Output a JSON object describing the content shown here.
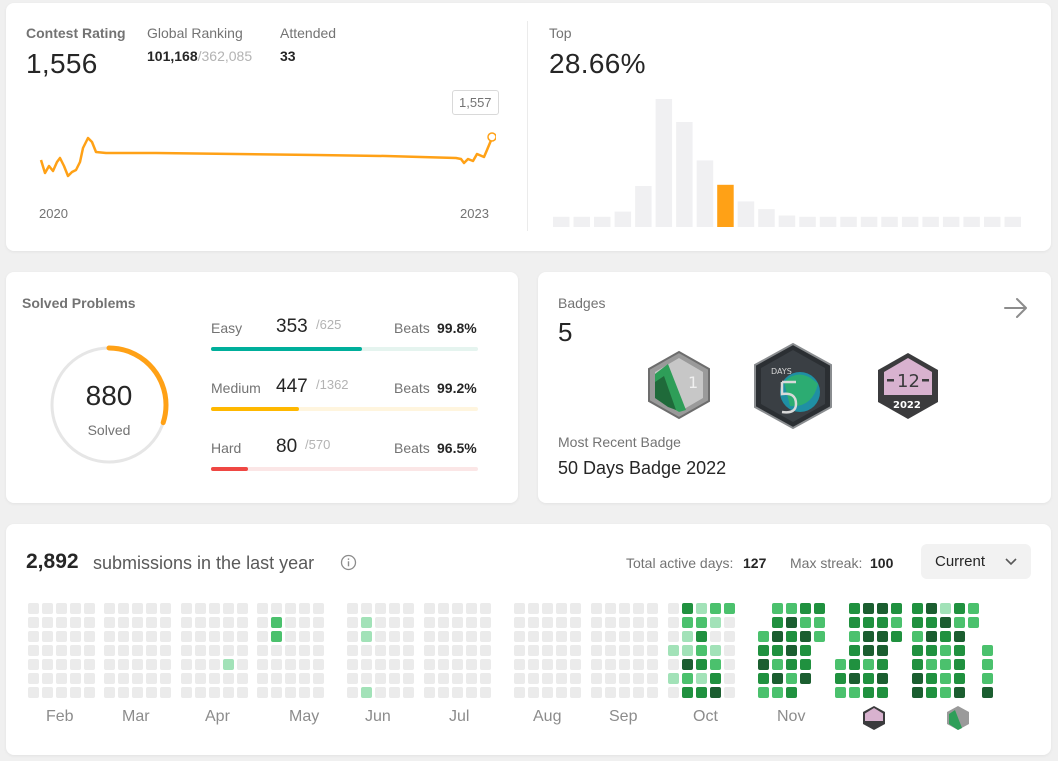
{
  "contest": {
    "rating_label": "Contest Rating",
    "rating_value": "1,556",
    "ranking_label": "Global Ranking",
    "ranking_value": "101,168",
    "ranking_total": "/362,085",
    "attended_label": "Attended",
    "attended_value": "33",
    "tooltip_value": "1,557",
    "year_start": "2020",
    "year_end": "2023",
    "line_color": "#ffa116"
  },
  "top": {
    "label": "Top",
    "value": "28.66%",
    "histogram": [
      0.08,
      0.08,
      0.08,
      0.12,
      0.32,
      1.0,
      0.82,
      0.52,
      0.33,
      0.2,
      0.14,
      0.09,
      0.08,
      0.08,
      0.08,
      0.08,
      0.08,
      0.08,
      0.08,
      0.08,
      0.08,
      0.08,
      0.08
    ],
    "highlight_index": 8,
    "bar_color": "#f0f0f2",
    "highlight_color": "#ffa116"
  },
  "solved": {
    "title": "Solved Problems",
    "count": "880",
    "count_label": "Solved",
    "ring_fraction": 0.3,
    "ring_color": "#ffa116",
    "easy": {
      "label": "Easy",
      "value": "353",
      "total": "/625",
      "beats_label": "Beats",
      "beats_value": "99.8%",
      "fraction": 0.565,
      "color": "#00af9b",
      "track": "#e5f4ef"
    },
    "medium": {
      "label": "Medium",
      "value": "447",
      "total": "/1362",
      "beats_label": "Beats",
      "beats_value": "99.2%",
      "fraction": 0.328,
      "color": "#ffb800",
      "track": "#fff5de"
    },
    "hard": {
      "label": "Hard",
      "value": "80",
      "total": "/570",
      "beats_label": "Beats",
      "beats_value": "96.5%",
      "fraction": 0.14,
      "color": "#ef4743",
      "track": "#fbe6e6"
    }
  },
  "badges": {
    "label": "Badges",
    "count": "5",
    "recent_label": "Most Recent Badge",
    "recent_value": "50 Days Badge 2022",
    "badge1_text": "1",
    "badge2_text": "DAYS",
    "badge3_text": "12",
    "badge3_year": "2022"
  },
  "submissions": {
    "count": "2,892",
    "label": "submissions in the last year",
    "active_label": "Total active days:",
    "active_value": "127",
    "streak_label": "Max streak:",
    "streak_value": "100",
    "period": "Current",
    "months": [
      "Feb",
      "Mar",
      "Apr",
      "May",
      "Jun",
      "Jul",
      "Aug",
      "Sep",
      "Oct",
      "Nov"
    ],
    "colors": [
      "#ebebeb",
      "#a2e2b8",
      "#4bc16d",
      "#20913f",
      "#1b5e30"
    ]
  }
}
